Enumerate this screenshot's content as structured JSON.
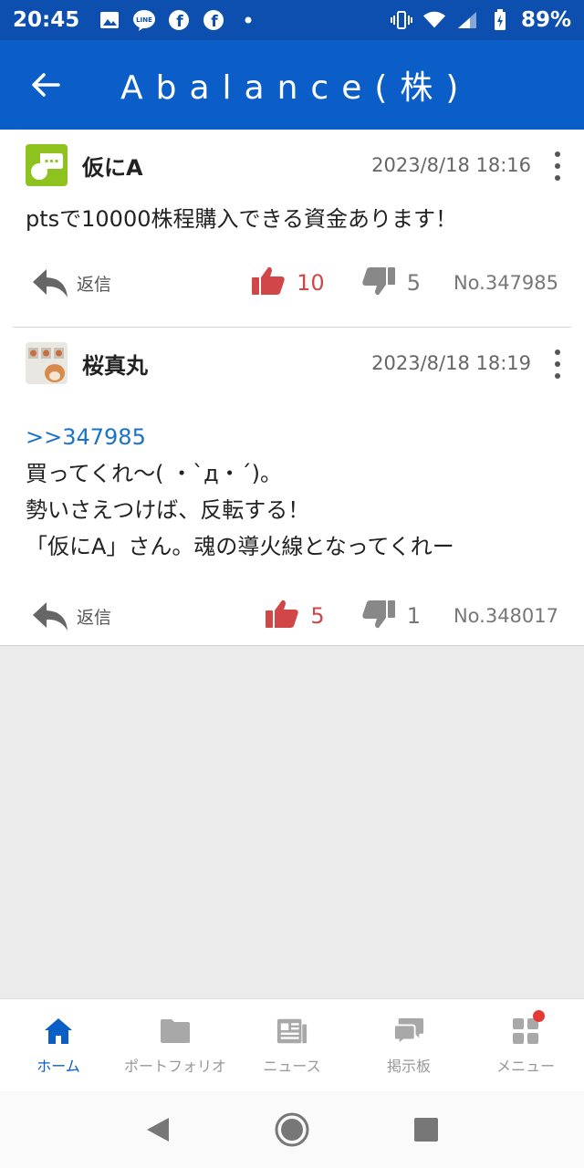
{
  "status_bar": {
    "time": "20:45",
    "battery": "89%",
    "left_icons": [
      "gallery-icon",
      "line-icon",
      "facebook-icon",
      "facebook-icon",
      "dot-icon"
    ],
    "right_icons": [
      "vibrate-icon",
      "wifi-icon",
      "signal-icon",
      "battery-icon"
    ]
  },
  "app_bar": {
    "title": "Abalance(株)"
  },
  "posts": [
    {
      "author": "仮にA",
      "date": "2023/8/18 18:16",
      "lines": [
        "ptsで10000株程購入できる資金あります！"
      ],
      "anchor": "",
      "reply_label": "返信",
      "likes": "10",
      "dislikes": "5",
      "number": "No.347985"
    },
    {
      "author": "桜真丸",
      "date": "2023/8/18 18:19",
      "anchor": ">>347985",
      "lines": [
        "買ってくれ〜( ・`д・´)。",
        "勢いさえつけば、反転する！",
        "「仮にA」さん。魂の導火線となってくれー"
      ],
      "reply_label": "返信",
      "likes": "5",
      "dislikes": "1",
      "number": "No.348017"
    }
  ],
  "bottom_nav": [
    {
      "label": "ホーム",
      "icon": "home-icon",
      "active": true
    },
    {
      "label": "ポートフォリオ",
      "icon": "folder-icon",
      "active": false
    },
    {
      "label": "ニュース",
      "icon": "news-icon",
      "active": false
    },
    {
      "label": "掲示板",
      "icon": "chat-icon",
      "active": false
    },
    {
      "label": "メニュー",
      "icon": "grid-icon",
      "active": false,
      "badge": true
    }
  ],
  "colors": {
    "status_bar": "#0c4fae",
    "app_bar": "#0b5ec8",
    "like": "#d14646",
    "anchor": "#1a73c7"
  }
}
